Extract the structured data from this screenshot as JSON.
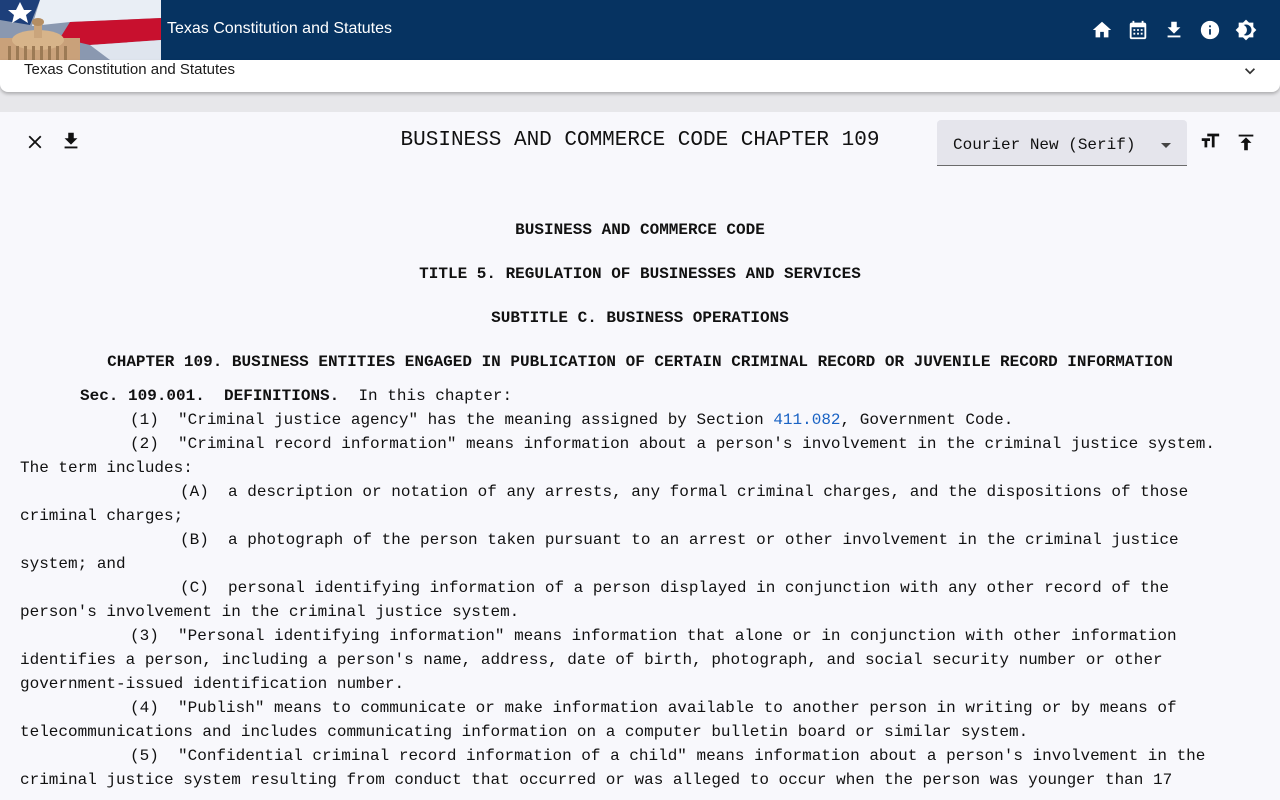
{
  "app": {
    "title": "Texas Constitution and Statutes",
    "bar_color": "#063361",
    "accent": "#c9a227",
    "actions": [
      "home-icon",
      "calendar-icon",
      "download-icon",
      "info-icon",
      "brightness-icon"
    ]
  },
  "panel": {
    "title": "Texas Constitution and Statutes",
    "chevron": "chevron-down-icon"
  },
  "viewer": {
    "title": "BUSINESS AND COMMERCE CODE CHAPTER 109",
    "font_select": {
      "value": "Courier New (Serif)"
    },
    "tools": [
      "close-icon",
      "download-icon",
      "text-size-icon",
      "scroll-to-top-icon"
    ]
  },
  "document": {
    "heading1": "BUSINESS AND COMMERCE CODE",
    "heading2": "TITLE 5.  REGULATION OF BUSINESSES AND SERVICES",
    "heading3": "SUBTITLE C.  BUSINESS OPERATIONS",
    "heading4": "CHAPTER 109.  BUSINESS ENTITIES ENGAGED IN PUBLICATION OF CERTAIN CRIMINAL RECORD OR JUVENILE RECORD INFORMATION",
    "sec_label": "Sec. 109.001.  DEFINITIONS.",
    "sec_intro": "  In this chapter:",
    "p1_pre": "(1)  \"Criminal justice agency\" has the meaning assigned by Section ",
    "p1_link": "411.082",
    "p1_post": ", Government Code.",
    "p2_l1": "(2)  \"Criminal record information\" means information about a person's involvement in the criminal justice system.",
    "p2_l2": "The term includes:",
    "pA_l1": "(A)  a description or notation of any arrests, any formal criminal charges, and the dispositions of those",
    "pA_l2": "criminal charges;",
    "pB_l1": "(B)  a photograph of the person taken pursuant to an arrest or other involvement in the criminal justice",
    "pB_l2": "system; and",
    "pC_l1": "(C)  personal identifying information of a person displayed in conjunction with any other record of the",
    "pC_l2": "person's involvement in the criminal justice system.",
    "p3_l1": "(3)  \"Personal identifying information\" means information that alone or in conjunction with other information",
    "p3_l2": "identifies a person, including a person's name, address, date of birth, photograph, and social security number or other",
    "p3_l3": "government-issued identification number.",
    "p4_l1": "(4)  \"Publish\" means to communicate or make information available to another person in writing or by means of",
    "p4_l2": "telecommunications and includes communicating information on a computer bulletin board or similar system.",
    "p5_l1": "(5)  \"Confidential criminal record information of a child\" means information about a person's involvement in the",
    "p5_l2": "criminal justice system resulting from conduct that occurred or was alleged to occur when the person was younger than 17"
  }
}
